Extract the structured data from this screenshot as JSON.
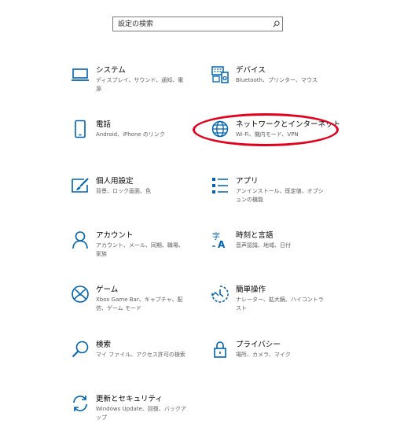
{
  "search": {
    "placeholder": "設定の検索"
  },
  "colors": {
    "accent": "#0063b1",
    "highlight": "#e2001a"
  },
  "tiles": [
    {
      "icon": "laptop-icon",
      "title": "システム",
      "desc": "ディスプレイ、サウンド、通知、電源"
    },
    {
      "icon": "keyboard-devices-icon",
      "title": "デバイス",
      "desc": "Bluetooth、プリンター、マウス"
    },
    {
      "icon": "phone-icon",
      "title": "電話",
      "desc": "Android、iPhone のリンク"
    },
    {
      "icon": "globe-icon",
      "title": "ネットワークとインターネット",
      "desc": "Wi-Fi、機内モード、VPN"
    },
    {
      "icon": "paint-icon",
      "title": "個人用設定",
      "desc": "背景、ロック画面、色"
    },
    {
      "icon": "apps-list-icon",
      "title": "アプリ",
      "desc": "アンインストール、既定値、オプションの機能"
    },
    {
      "icon": "person-icon",
      "title": "アカウント",
      "desc": "アカウント、メール、同期、職場、家族"
    },
    {
      "icon": "time-language-icon",
      "title": "時刻と言語",
      "desc": "音声認識、地域、日付"
    },
    {
      "icon": "xbox-icon",
      "title": "ゲーム",
      "desc": "Xbox Game Bar、キャプチャ、配信、ゲーム モード"
    },
    {
      "icon": "ease-of-access-icon",
      "title": "簡単操作",
      "desc": "ナレーター、拡大鏡、ハイコントラスト"
    },
    {
      "icon": "search-icon",
      "title": "検索",
      "desc": "マイ ファイル、アクセス許可の検索"
    },
    {
      "icon": "lock-icon",
      "title": "プライバシー",
      "desc": "場所、カメラ、マイク"
    },
    {
      "icon": "sync-icon",
      "title": "更新とセキュリティ",
      "desc": "Windows Update、回復、バックアップ"
    }
  ]
}
